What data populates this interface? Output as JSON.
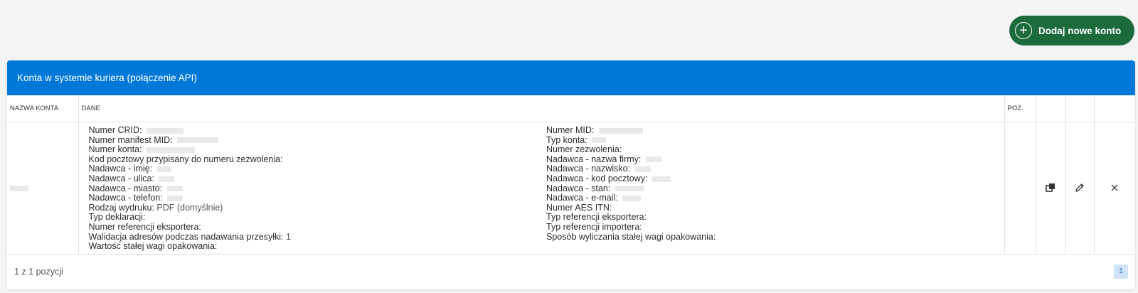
{
  "toolbar": {
    "add_account_label": "Dodaj nowe konto"
  },
  "panel": {
    "title": "Konta w systemie kuriera (połączenie API)"
  },
  "table": {
    "columns": {
      "name": "NAZWA KONTA",
      "data": "DANE",
      "pos": "POZ."
    },
    "row": {
      "left_fields": [
        {
          "label": "Numer CRID:",
          "value": ""
        },
        {
          "label": "Numer manifest MID:",
          "value": ""
        },
        {
          "label": "Numer konta:",
          "value": ""
        },
        {
          "label": "Kod pocztowy przypisany do numeru zezwolenia:",
          "value": ""
        },
        {
          "label": "Nadawca - imię:",
          "value": ""
        },
        {
          "label": "Nadawca - ulica:",
          "value": ""
        },
        {
          "label": "Nadawca - miasto:",
          "value": ""
        },
        {
          "label": "Nadawca - telefon:",
          "value": ""
        },
        {
          "label": "Rodzaj wydruku:",
          "value": "PDF (domyślnie)"
        },
        {
          "label": "Typ deklaracji:",
          "value": ""
        },
        {
          "label": "Numer referencji eksportera:",
          "value": ""
        },
        {
          "label": "Walidacja adresów podczas nadawania przesyłki:",
          "value": "1"
        },
        {
          "label": "Wartość stałej wagi opakowania:",
          "value": ""
        }
      ],
      "right_fields": [
        {
          "label": "Numer MID:",
          "value": ""
        },
        {
          "label": "Typ konta:",
          "value": ""
        },
        {
          "label": "Numer zezwolenia:",
          "value": ""
        },
        {
          "label": "Nadawca - nazwa firmy:",
          "value": ""
        },
        {
          "label": "Nadawca - nazwisko:",
          "value": ""
        },
        {
          "label": "Nadawca - kod pocztowy:",
          "value": ""
        },
        {
          "label": "Nadawca - stan:",
          "value": ""
        },
        {
          "label": "Nadawca - e-mail:",
          "value": ""
        },
        {
          "label": "Numer AES ITN:",
          "value": ""
        },
        {
          "label": "Typ referencji eksportera:",
          "value": ""
        },
        {
          "label": "Typ referencji importera:",
          "value": ""
        },
        {
          "label": "Sposób wyliczania stałej wagi opakowania:",
          "value": ""
        }
      ]
    }
  },
  "footer": {
    "summary": "1 z 1 pozycji",
    "current_page": "1"
  },
  "icons": {
    "add": "plus-circle-icon",
    "copy": "copy-icon",
    "edit": "pencil-icon",
    "delete": "close-icon"
  },
  "colors": {
    "header_bg": "#0078d7",
    "add_button_bg": "#1c6b3c",
    "page_active_bg": "#cfe3f8"
  }
}
